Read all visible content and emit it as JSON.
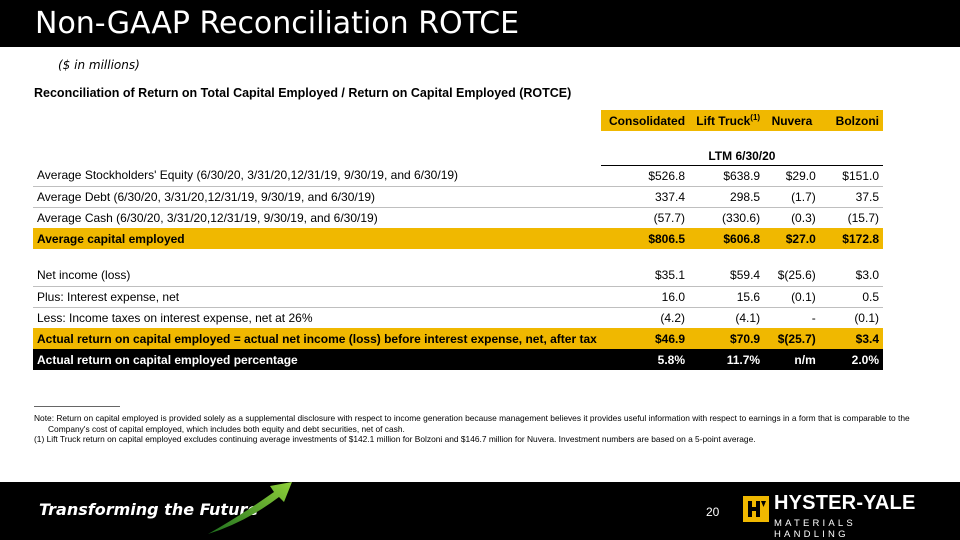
{
  "slide": {
    "title": "Non-GAAP Reconciliation ROTCE",
    "subtitle": "($ in millions)",
    "heading": "Reconciliation of Return on Total Capital Employed / Return on Capital Employed (ROTCE)"
  },
  "table": {
    "columns": [
      {
        "label": "Consolidated",
        "sup": ""
      },
      {
        "label": "Lift Truck",
        "sup": "(1)"
      },
      {
        "label": "Nuvera",
        "sup": ""
      },
      {
        "label": "Bolzoni",
        "sup": ""
      }
    ],
    "period": "LTM 6/30/20",
    "rows": [
      {
        "label": "Average Stockholders' Equity (6/30/20, 3/31/20,12/31/19, 9/30/19, and 6/30/19)",
        "values": [
          "$526.8",
          "$638.9",
          "$29.0",
          "$151.0"
        ]
      },
      {
        "label": "Average Debt (6/30/20, 3/31/20,12/31/19, 9/30/19, and 6/30/19)",
        "values": [
          "337.4",
          "298.5",
          "(1.7)",
          "37.5"
        ]
      },
      {
        "label": "Average Cash (6/30/20, 3/31/20,12/31/19, 9/30/19, and 6/30/19)",
        "values": [
          "(57.7)",
          "(330.6)",
          "(0.3)",
          "(15.7)"
        ]
      },
      {
        "label": "Average capital employed",
        "values": [
          "$806.5",
          "$606.8",
          "$27.0",
          "$172.8"
        ]
      },
      {
        "label": "Net income (loss)",
        "values": [
          "$35.1",
          "$59.4",
          "$(25.6)",
          "$3.0"
        ]
      },
      {
        "label": "Plus: Interest expense, net",
        "values": [
          "16.0",
          "15.6",
          "(0.1)",
          "0.5"
        ]
      },
      {
        "label": "Less: Income taxes on interest expense, net at 26%",
        "values": [
          "(4.2)",
          "(4.1)",
          "-",
          "(0.1)"
        ]
      },
      {
        "label": "Actual return on capital employed = actual net income (loss) before interest expense, net, after tax",
        "values": [
          "$46.9",
          "$70.9",
          "$(25.7)",
          "$3.4"
        ]
      },
      {
        "label": "Actual return on capital employed percentage",
        "values": [
          "5.8%",
          "11.7%",
          "n/m",
          "2.0%"
        ]
      }
    ]
  },
  "notes": {
    "note1": "Note: Return on capital employed is provided solely as a supplemental disclosure with respect to income generation because management believes it provides useful information with respect to earnings in a form that is comparable to the",
    "note1_cont": "Company's cost of capital employed, which includes both equity and debt securities, net of cash.",
    "note2": "(1) Lift Truck return on capital employed excludes continuing average investments of $142.1 million for Bolzoni and $146.7 million for Nuvera.  Investment numbers are based on a 5-point average."
  },
  "footer": {
    "tagline": "Transforming the Future",
    "page_number": "20",
    "logo_name": "HYSTER-YALE",
    "logo_sub": "MATERIALS HANDLING"
  },
  "colors": {
    "accent": "#f0b800",
    "dark": "#000000"
  }
}
